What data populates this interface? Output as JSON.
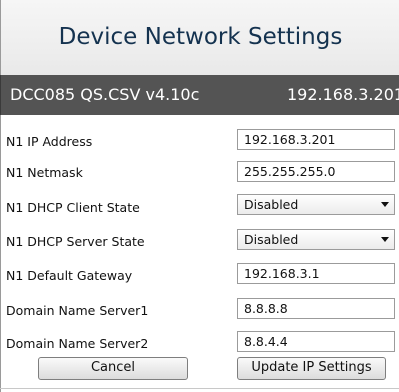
{
  "header": {
    "title": "Device Network Settings"
  },
  "info_bar": {
    "config_name": "DCC085 QS.CSV v4.10c",
    "ip": "192.168.3.201"
  },
  "form": {
    "rows": [
      {
        "label": "N1 IP Address",
        "value": "192.168.3.201",
        "type": "text"
      },
      {
        "label": "N1 Netmask",
        "value": "255.255.255.0",
        "type": "text"
      },
      {
        "label": "N1 DHCP Client State",
        "value": "Disabled",
        "type": "select"
      },
      {
        "label": "N1 DHCP Server State",
        "value": "Disabled",
        "type": "select"
      },
      {
        "label": "N1 Default Gateway",
        "value": "192.168.3.1",
        "type": "text"
      },
      {
        "label": "Domain Name Server1",
        "value": "8.8.8.8",
        "type": "text"
      },
      {
        "label": "Domain Name Server2",
        "value": "8.8.4.4",
        "type": "text"
      }
    ]
  },
  "buttons": {
    "cancel": "Cancel",
    "update": "Update IP Settings"
  },
  "icons": {
    "dropdown": "chevron-down-icon"
  }
}
